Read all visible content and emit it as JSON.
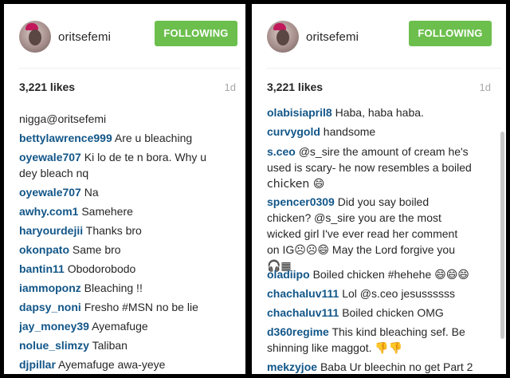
{
  "panels": [
    {
      "username": "oritsefemi",
      "follow_label": "FOLLOWING",
      "likes": "3,221 likes",
      "time_ago": "1d",
      "partial_text": "nigga@oritsefemi",
      "comments": [
        {
          "user": "bettylawrence999",
          "lines": [
            "Are u bleaching"
          ]
        },
        {
          "user": "oyewale707",
          "lines": [
            "Ki lo de te n bora. Why u",
            "dey bleach nq"
          ]
        },
        {
          "user": "oyewale707",
          "lines": [
            "Na"
          ]
        },
        {
          "user": "awhy.com1",
          "lines": [
            "Samehere"
          ]
        },
        {
          "user": "haryourdejii",
          "lines": [
            "Thanks bro"
          ]
        },
        {
          "user": "okonpato",
          "lines": [
            "Same bro"
          ]
        },
        {
          "user": "bantin11",
          "lines": [
            "Obodorobodo"
          ]
        },
        {
          "user": "iammoponz",
          "lines": [
            "Bleaching !!"
          ]
        },
        {
          "user": "dapsy_noni",
          "lines": [
            "Fresho #MSN no be lie"
          ]
        },
        {
          "user": "jay_money39",
          "lines": [
            "Ayemafuge"
          ]
        },
        {
          "user": "nolue_slimzy",
          "lines": [
            "Taliban"
          ]
        },
        {
          "user": "djpillar",
          "lines": [
            "Ayemafuge awa-yeye"
          ]
        }
      ]
    },
    {
      "username": "oritsefemi",
      "follow_label": "FOLLOWING",
      "likes": "3,221 likes",
      "time_ago": "1d",
      "comments": [
        {
          "user": "olabisiapril8",
          "lines": [
            "Haba, haba haba."
          ]
        },
        {
          "user": "curvygold",
          "lines": [
            "handsome"
          ]
        },
        {
          "user": "s.ceo",
          "lines": [
            "@s_sire the amount of cream he's",
            "used is scary- he now resembles a boiled",
            "chicken 😄"
          ]
        },
        {
          "user": "spencer0309",
          "lines": [
            "Did you say boiled",
            "chicken? @s_sire you are the most",
            "wicked girl I've ever read her comment",
            "on IG☹☹😄 May the Lord forgive you",
            "🎧▦"
          ]
        },
        {
          "user": "oladiipo",
          "lines": [
            "Boiled chicken #hehehe 😄😄😄"
          ]
        },
        {
          "user": "chachaluv111",
          "lines": [
            "Lol @s.ceo jesussssss"
          ]
        },
        {
          "user": "chachaluv111",
          "lines": [
            "Boiled chicken OMG"
          ]
        },
        {
          "user": "d360regime",
          "lines": [
            "This kind bleaching sef. Be",
            "shinning like maggot. 👎👎"
          ]
        },
        {
          "user": "mekzyjoe",
          "lines": [
            "Baba Ur bleechin no get Part 2"
          ]
        }
      ]
    }
  ]
}
